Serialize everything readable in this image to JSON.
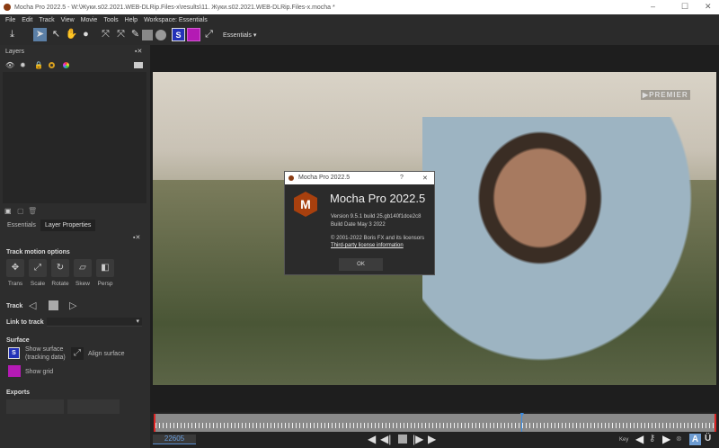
{
  "window": {
    "title": "Mocha Pro 2022.5 - W:\\Жуки.s02.2021.WEB-DLRip.Files-x\\results\\11. Жуки.s02.2021.WEB-DLRip.Files-x.mocha *",
    "minimize": "–",
    "maximize": "☐",
    "close": "✕"
  },
  "menu": [
    "File",
    "Edit",
    "Track",
    "View",
    "Movie",
    "Tools",
    "Help",
    "Workspace: Essentials"
  ],
  "toolbar": {
    "workspace": "Essentials"
  },
  "layers": {
    "title": "Layers"
  },
  "tabs": [
    "Essentials",
    "Layer Properties"
  ],
  "props": {
    "track_motion": "Track motion options",
    "motions": [
      "Trans",
      "Scale",
      "Rotate",
      "Skew",
      "Persp"
    ],
    "track": "Track",
    "link_to_track": "Link to track",
    "surface": "Surface",
    "show_surface": "Show surface",
    "tracking_data": "(tracking data)",
    "align_surface": "Align surface",
    "show_grid": "Show grid",
    "exports": "Exports"
  },
  "video": {
    "watermark": "▶PREMIER"
  },
  "dialog": {
    "title": "Mocha Pro 2022.5",
    "help": "?",
    "close": "✕",
    "product": "Mocha Pro 2022.5",
    "version": "Version 9.5.1 build 25.gb140f1dce2c8",
    "build_date": "Build Date May 3 2022",
    "copyright": "© 2001-2022 Boris FX and its licensors",
    "license_link": "Third-party license information",
    "ok": "OK"
  },
  "timeline": {
    "frame": "22605",
    "key": "Key",
    "playhead_fraction": 0.655
  }
}
